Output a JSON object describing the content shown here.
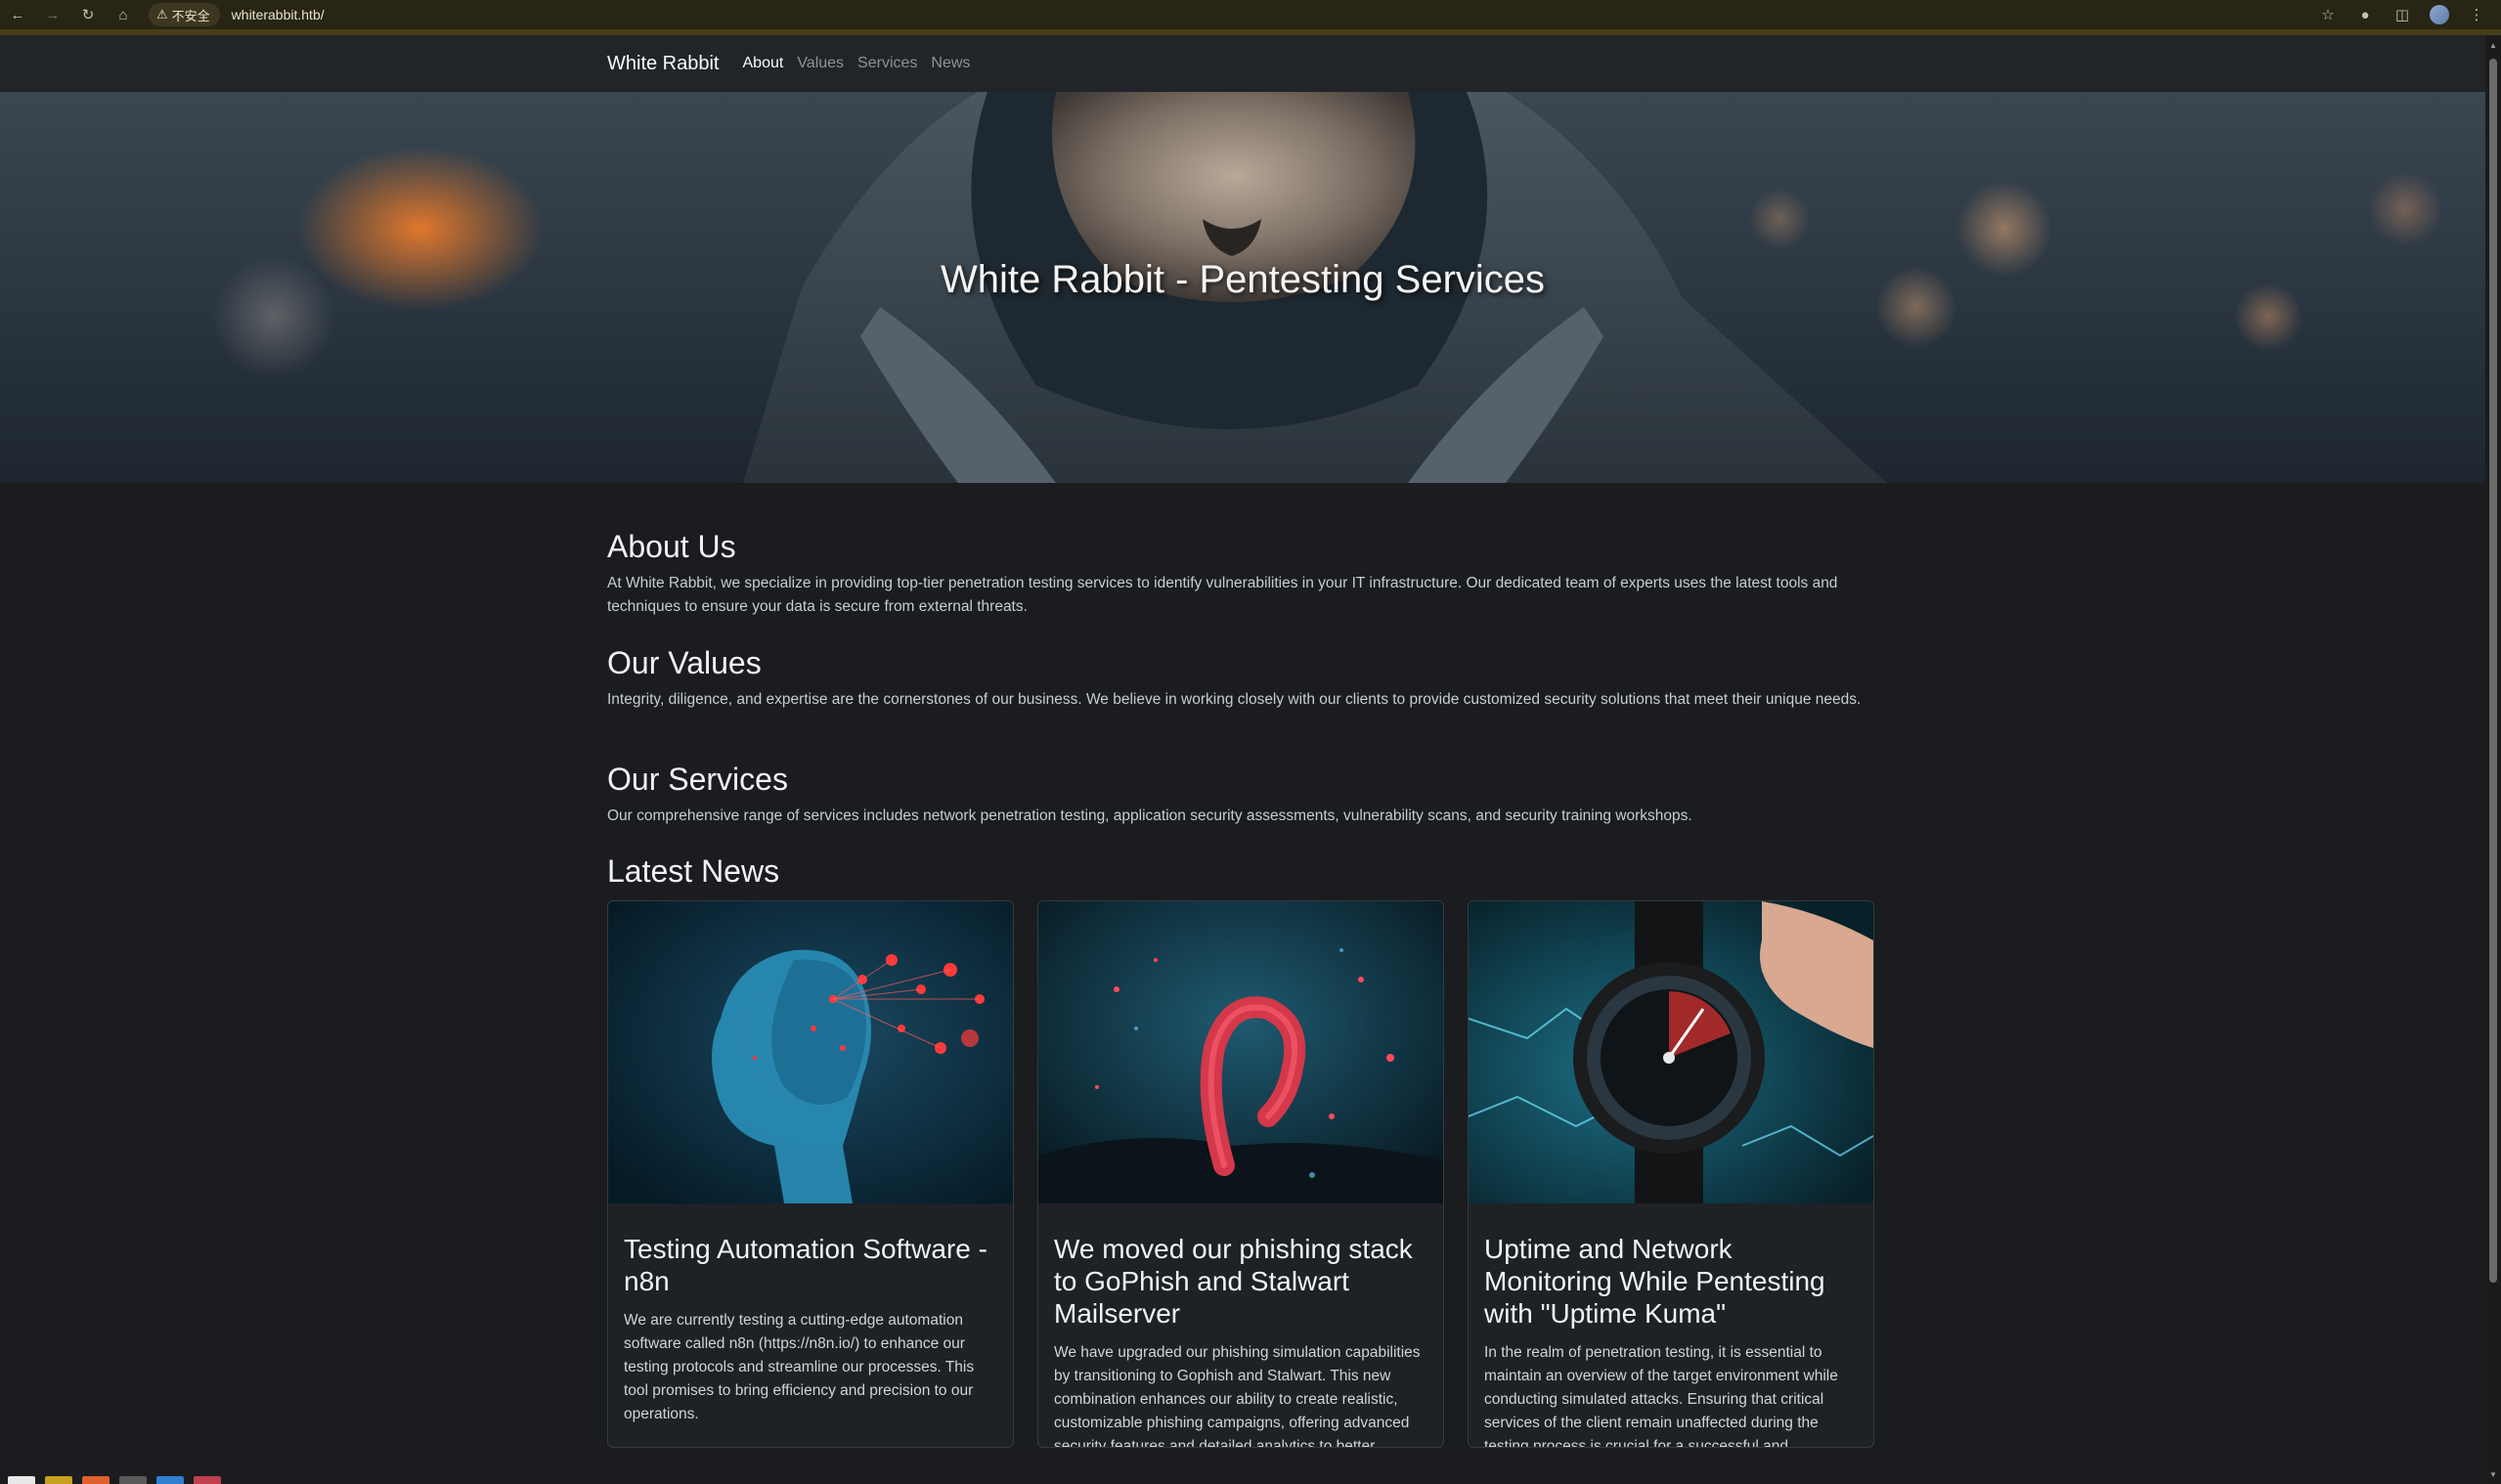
{
  "browser": {
    "security_label": "不安全",
    "url": "whiterabbit.htb/"
  },
  "nav": {
    "brand": "White Rabbit",
    "links": [
      "About",
      "Values",
      "Services",
      "News"
    ]
  },
  "hero": {
    "title": "White Rabbit - Pentesting Services"
  },
  "about": {
    "title": "About Us",
    "text": "At White Rabbit, we specialize in providing top-tier penetration testing services to identify vulnerabilities in your IT infrastructure. Our dedicated team of experts uses the latest tools and techniques to ensure your data is secure from external threats."
  },
  "values": {
    "title": "Our Values",
    "text": "Integrity, diligence, and expertise are the cornerstones of our business. We believe in working closely with our clients to provide customized security solutions that meet their unique needs."
  },
  "services": {
    "title": "Our Services",
    "text": "Our comprehensive range of services includes network penetration testing, application security assessments, vulnerability scans, and security training workshops."
  },
  "news": {
    "title": "Latest News",
    "cards": [
      {
        "title": "Testing Automation Software - n8n",
        "text": "We are currently testing a cutting-edge automation software called n8n (https://n8n.io/) to enhance our testing protocols and streamline our processes. This tool promises to bring efficiency and precision to our operations."
      },
      {
        "title": "We moved our phishing stack to GoPhish and Stalwart Mailserver",
        "text": "We have upgraded our phishing simulation capabilities by transitioning to Gophish and Stalwart. This new combination enhances our ability to create realistic, customizable phishing campaigns, offering advanced security features and detailed analytics to better prepare and protect our clients against cyber"
      },
      {
        "title": "Uptime and Network Monitoring While Pentesting with \"Uptime Kuma\"",
        "text": "In the realm of penetration testing, it is essential to maintain an overview of the target environment while conducting simulated attacks. Ensuring that critical services of the client remain unaffected during the testing process is crucial for a successful and comprehensive assessment. Network"
      }
    ]
  },
  "colors": {
    "page_bg": "#1a1c1f",
    "navbar_bg": "#212529",
    "chrome_bg": "#282515"
  }
}
